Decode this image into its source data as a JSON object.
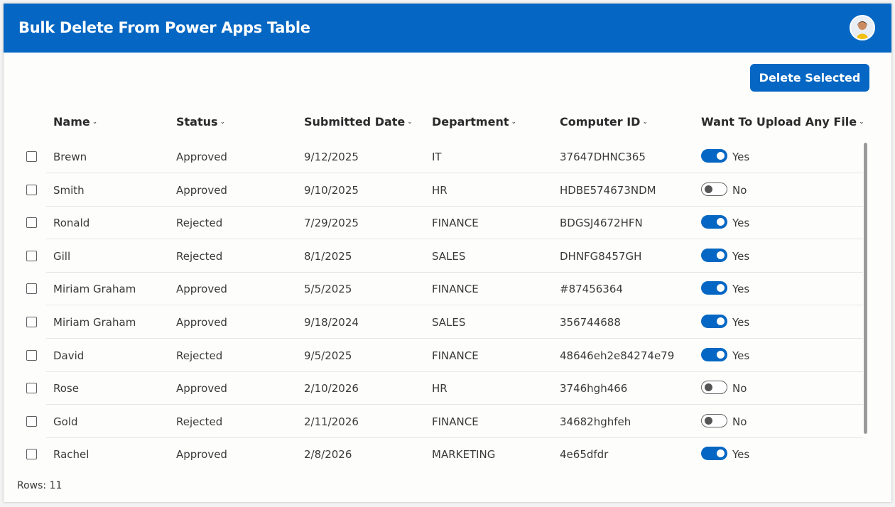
{
  "header": {
    "title": "Bulk Delete From Power Apps Table",
    "avatar_icon": "user-avatar"
  },
  "toolbar": {
    "delete_label": "Delete Selected"
  },
  "colors": {
    "brand": "#0567c3",
    "background": "#fdfdfc"
  },
  "table": {
    "columns": [
      "Name",
      "Status",
      "Submitted Date",
      "Department",
      "Computer ID",
      "Want To Upload Any File"
    ],
    "rows": [
      {
        "name": "Brewn",
        "status": "Approved",
        "date": "9/12/2025",
        "dept": "IT",
        "computer_id": "37647DHNC365",
        "upload": true,
        "upload_label": "Yes"
      },
      {
        "name": "Smith",
        "status": "Approved",
        "date": "9/10/2025",
        "dept": "HR",
        "computer_id": "HDBE574673NDM",
        "upload": false,
        "upload_label": "No"
      },
      {
        "name": "Ronald",
        "status": "Rejected",
        "date": "7/29/2025",
        "dept": "FINANCE",
        "computer_id": "BDGSJ4672HFN",
        "upload": true,
        "upload_label": "Yes"
      },
      {
        "name": "Gill",
        "status": "Rejected",
        "date": "8/1/2025",
        "dept": "SALES",
        "computer_id": "DHNFG8457GH",
        "upload": true,
        "upload_label": "Yes"
      },
      {
        "name": "Miriam Graham",
        "status": "Approved",
        "date": "5/5/2025",
        "dept": "FINANCE",
        "computer_id": "#87456364",
        "upload": true,
        "upload_label": "Yes"
      },
      {
        "name": "Miriam Graham",
        "status": "Approved",
        "date": "9/18/2024",
        "dept": "SALES",
        "computer_id": "356744688",
        "upload": true,
        "upload_label": "Yes"
      },
      {
        "name": "David",
        "status": "Rejected",
        "date": "9/5/2025",
        "dept": "FINANCE",
        "computer_id": "48646eh2e84274e79",
        "upload": true,
        "upload_label": "Yes"
      },
      {
        "name": "Rose",
        "status": "Approved",
        "date": "2/10/2026",
        "dept": "HR",
        "computer_id": "3746hgh466",
        "upload": false,
        "upload_label": "No"
      },
      {
        "name": "Gold",
        "status": "Rejected",
        "date": "2/11/2026",
        "dept": "FINANCE",
        "computer_id": "34682hghfeh",
        "upload": false,
        "upload_label": "No"
      },
      {
        "name": "Rachel",
        "status": "Approved",
        "date": "2/8/2026",
        "dept": "MARKETING",
        "computer_id": "4e65dfdr",
        "upload": true,
        "upload_label": "Yes"
      }
    ]
  },
  "footer": {
    "rows_count": "Rows: 11"
  }
}
